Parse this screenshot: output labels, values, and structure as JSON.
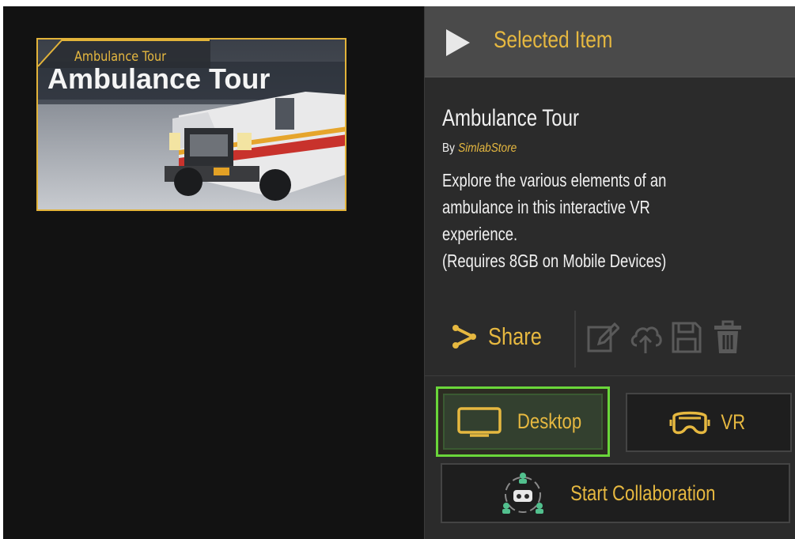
{
  "library": {
    "items": [
      {
        "title": "Ambulance Tour",
        "thumbnail_text": "Ambulance Tour"
      }
    ]
  },
  "details": {
    "header": {
      "title": "Selected Item"
    },
    "item": {
      "title": "Ambulance Tour",
      "by_prefix": "By",
      "author": "SimlabStore",
      "description": [
        "Explore the various elements of an",
        "ambulance in this interactive VR",
        "experience.",
        "(Requires 8GB on Mobile Devices)"
      ]
    },
    "actions": {
      "share_label": "Share",
      "icons": [
        "edit-icon",
        "upload-cloud-icon",
        "save-icon",
        "trash-icon"
      ]
    },
    "launch": {
      "desktop_label": "Desktop",
      "vr_label": "VR",
      "collab_label": "Start Collaboration",
      "selected": "Desktop"
    }
  },
  "colors": {
    "accent": "#e6b840",
    "selected_border": "#6ad63a",
    "panel_bg": "#2b2b2b",
    "header_bg": "#4a4a4a",
    "app_bg": "#121212"
  }
}
